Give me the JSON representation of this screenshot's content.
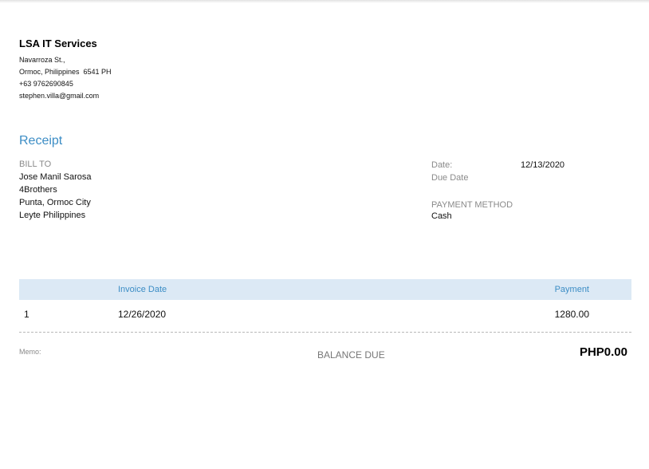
{
  "company": {
    "name": "LSA IT Services",
    "address_line1": "Navarroza St.,",
    "address_line2": "Ormoc, Philippines  6541 PH",
    "phone": "+63 9762690845",
    "email": "stephen.villa@gmail.com"
  },
  "receipt": {
    "title": "Receipt"
  },
  "bill_to": {
    "label": "BILL TO",
    "name": "Jose Manil Sarosa",
    "line1": "4Brothers",
    "line2": "Punta, Ormoc City",
    "line3": "Leyte Philippines"
  },
  "meta": {
    "date_label": "Date:",
    "date_value": "12/13/2020",
    "due_date_label": "Due Date",
    "due_date_value": "",
    "payment_method_label": "PAYMENT METHOD",
    "payment_method_value": "Cash"
  },
  "table": {
    "headers": {
      "num": "",
      "invoice_date": "Invoice Date",
      "payment": "Payment"
    },
    "rows": [
      {
        "num": "1",
        "invoice_date": "12/26/2020",
        "payment": "1280.00"
      }
    ]
  },
  "footer": {
    "memo_label": "Memo:",
    "balance_due_label": "BALANCE DUE",
    "balance_due_amount": "PHP0.00"
  },
  "colors": {
    "accent": "#3c8dc5",
    "header_bg": "#dce9f5",
    "label_grey": "#8a8a8a"
  }
}
